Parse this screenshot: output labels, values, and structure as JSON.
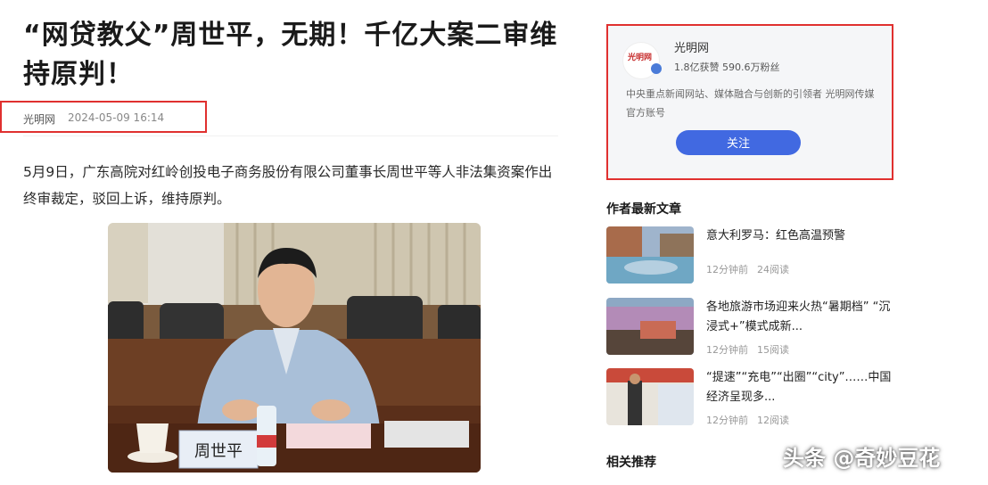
{
  "article": {
    "title": "“网贷教父”周世平，无期！千亿大案二审维持原判！",
    "source": "光明网",
    "time": "2024-05-09 16:14",
    "body": "5月9日，广东高院对红岭创投电子商务股份有限公司董事长周世平等人非法集资案作出终审裁定，驳回上诉，维持原判。",
    "photo_nameplate": "周世平"
  },
  "author": {
    "logo_text": "光明网",
    "name": "光明网",
    "stats": "1.8亿获赞 590.6万粉丝",
    "desc": "中央重点新闻网站、媒体融合与创新的引领者 光明网传媒官方账号",
    "follow_label": "关注"
  },
  "sidebar": {
    "latest_title": "作者最新文章",
    "related_title": "相关推荐",
    "articles": [
      {
        "title": "意大利罗马：红色高温预警",
        "time": "12分钟前",
        "reads": "24阅读"
      },
      {
        "title": "各地旅游市场迎来火热“暑期档” “沉浸式+”模式成新...",
        "time": "12分钟前",
        "reads": "15阅读"
      },
      {
        "title": "“提速”“充电”“出圈”“city”……中国经济呈现多...",
        "time": "12分钟前",
        "reads": "12阅读"
      }
    ]
  },
  "watermark": "头条 @奇妙豆花",
  "colors": {
    "highlight": "#e0302f",
    "follow": "#4169e1"
  }
}
